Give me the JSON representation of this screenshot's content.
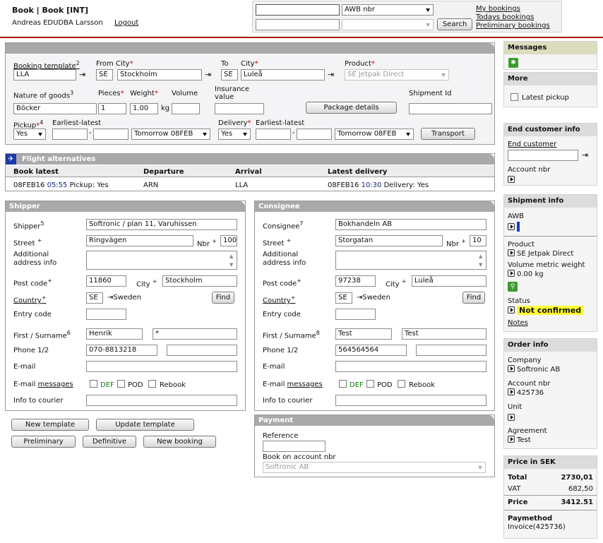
{
  "header": {
    "breadcrumb": "Book | Book [INT]",
    "user": "Andreas EDUDBA Larsson",
    "logout": "Logout",
    "search_value": "",
    "search_type": "AWB nbr",
    "search_input2": "",
    "search_select2": "",
    "search_button": "Search",
    "links": [
      "My bookings",
      "Todays bookings",
      "Preliminary bookings"
    ]
  },
  "booking": {
    "template_label": "Booking template",
    "template_sup": "2",
    "template_value": "LLA",
    "from_label": "From",
    "city_label": "City",
    "from_country": "SE",
    "from_city": "Stockholm",
    "to_label": "To",
    "to_country": "SE",
    "to_city": "Luleå",
    "product_label": "Product",
    "product_value": "SE Jetpak Direct",
    "nature_label": "Nature of goods",
    "nature_sup": "3",
    "nature_value": "Böcker",
    "pieces_label": "Pieces",
    "pieces_value": "1",
    "weight_label": "Weight",
    "weight_value": "1.00",
    "weight_unit": "kg",
    "volume_label": "Volume",
    "volume_value": "",
    "insurance_label": "Insurance value",
    "insurance_value": "",
    "package_button": "Package details",
    "shipment_id_label": "Shipment Id",
    "shipment_id_value": "",
    "pickup_label": "Pickup",
    "pickup_sup": "4",
    "earliest_latest": "Earliest-latest",
    "pickup_value": "Yes",
    "pickup_date": "Tomorrow 08FEB",
    "delivery_label": "Delivery",
    "delivery_value": "Yes",
    "delivery_date": "Tomorrow 08FEB",
    "transport_button": "Transport"
  },
  "flight": {
    "title": "Flight alternatives",
    "columns": [
      "Book latest",
      "Departure",
      "Arrival",
      "Latest delivery"
    ],
    "row": {
      "date": "08FEB16",
      "time": "05:55",
      "pickup": "Pickup: Yes",
      "departure": "ARN",
      "arrival": "LLA",
      "ldate": "08FEB16",
      "ltime": "10:30",
      "delivery": "Delivery: Yes"
    }
  },
  "shipper": {
    "title": "Shipper",
    "name_label": "Shipper",
    "name_sup": "5",
    "name": "Softronic / plan 11, Varuhissen",
    "street_label": "Street",
    "street": "Ringvägen",
    "nbr_label": "Nbr",
    "nbr": "100",
    "addinfo_label": "Additional address info",
    "addinfo": "",
    "post_label": "Post code",
    "post": "11860",
    "city_label": "City",
    "city": "Stockholm",
    "country_label": "Country",
    "country_code": "SE",
    "country_name": "Sweden",
    "find": "Find",
    "entry_label": "Entry code",
    "entry": "",
    "name2_label": "First / Surname",
    "name2_sup": "6",
    "first": "Henrik",
    "surname": "*",
    "phone_label": "Phone 1/2",
    "phone1": "070-8813218",
    "phone2": "",
    "email_label": "E-mail",
    "email": "",
    "email_msg_label": "E-mail",
    "messages": "messages",
    "def": "DEF",
    "pod": "POD",
    "rebook": "Rebook",
    "courier_label": "Info to courier",
    "courier": ""
  },
  "consignee": {
    "title": "Consignee",
    "name_label": "Consignee",
    "name_sup": "7",
    "name": "Bokhandeln AB",
    "street_label": "Street",
    "street": "Storgatan",
    "nbr_label": "Nbr",
    "nbr": "10",
    "addinfo_label": "Additional address info",
    "addinfo": "",
    "post_label": "Post code",
    "post": "97238",
    "city_label": "City",
    "city": "Luleå",
    "country_label": "Country",
    "country_code": "SE",
    "country_name": "Sweden",
    "find": "Find",
    "entry_label": "Entry code",
    "entry": "",
    "name2_label": "First / Surname",
    "name2_sup": "8",
    "first": "Test",
    "surname": "Test",
    "phone_label": "Phone 1/2",
    "phone1": "564564564",
    "phone2": "",
    "email_label": "E-mail",
    "email": "",
    "email_msg_label": "E-mail",
    "messages": "messages",
    "def": "DEF",
    "pod": "POD",
    "rebook": "Rebook",
    "courier_label": "Info to courier",
    "courier": ""
  },
  "payment": {
    "title": "Payment",
    "reference_label": "Reference",
    "reference": "",
    "account_label": "Book on account nbr",
    "account": "Softronic AB"
  },
  "buttons": {
    "new_template": "New template",
    "update_template": "Update template",
    "preliminary": "Preliminary",
    "definitive": "Definitive",
    "new_booking": "New booking"
  },
  "sidebar": {
    "messages": "Messages",
    "more": "More",
    "latest_pickup": "Latest pickup",
    "end_customer_title": "End customer info",
    "end_customer": "End customer",
    "end_customer_value": "",
    "account_nbr": "Account nbr",
    "shipment_title": "Shipment info",
    "awb": "AWB",
    "product": "Product",
    "product_value": "SE Jetpak Direct",
    "volume_weight": "Volume metric weight",
    "volume_weight_value": "0.00 kg",
    "status": "Status",
    "status_value": "Not confirmed",
    "notes": "Notes",
    "order_title": "Order info",
    "company": "Company",
    "company_value": "Softronic AB",
    "order_account": "Account nbr",
    "order_account_value": "425736",
    "unit": "Unit",
    "agreement": "Agreement",
    "agreement_value": "Test",
    "price_title": "Price in SEK",
    "total_label": "Total",
    "total": "2730,01",
    "vat_label": "VAT",
    "vat": "682,50",
    "price_label": "Price",
    "price": "3412.51",
    "paymethod_label": "Paymethod",
    "paymethod": "Invoice(425736)"
  },
  "colors": {
    "accent_red": "#b01010",
    "status_yellow": "#ffff33",
    "time_blue": "#1a237e",
    "def_green": "#1a7a1a"
  }
}
